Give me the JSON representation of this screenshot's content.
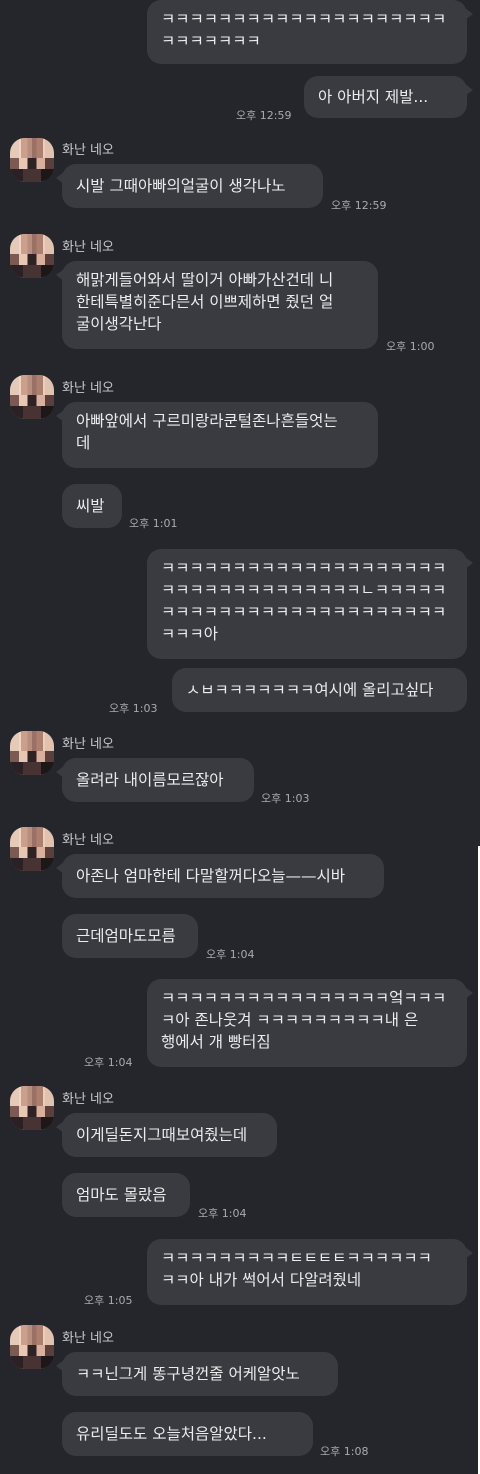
{
  "messages": [
    {
      "side": "mine",
      "text": "ㅋㅋㅋㅋㅋㅋㅋㅋㅋㅋㅋㅋㅋㅋㅋㅋㅋㅋㅋㅋ\nㅋㅋㅋㅋㅋㅋㅋ",
      "time": ""
    },
    {
      "side": "mine",
      "text": "아 아버지 제발...",
      "time": "오후 12:59"
    },
    {
      "side": "other",
      "name": "화난 네오",
      "text": "시발 그때아빠의얼굴이 생각나노",
      "time": "오후 12:59"
    },
    {
      "side": "other",
      "name": "화난 네오",
      "text": "해맑게들어와서 딸이거 아빠가산건데 니\n한테특별히준다믄서 이쁘제하면 줬던 얼\n굴이생각난다",
      "time": "오후 1:00"
    },
    {
      "side": "other",
      "name": "화난 네오",
      "text": "아빠앞에서 구르미랑라쿤털존나흔들엇는\n데",
      "time": ""
    },
    {
      "side": "other",
      "text": "씨발",
      "time": "오후 1:01"
    },
    {
      "side": "mine",
      "text": "ㅋㅋㅋㅋㅋㅋㅋㅋㅋㅋㅋㅋㅋㅋㅋㅋㅋㅋㅋㅋ\nㅋㅋㅋㅋㅋㅋㅋㅋㅋㅋㅋㅋㅋㅋㄴㅋㅋㅋㅋㅋ\nㅋㅋㅋㅋㅋㅋㅋㅋㅋㅋㅋㅋㅋㅋㅋㅋㅋㅋㅋㅋ\nㅋㅋㅋ아",
      "time": ""
    },
    {
      "side": "mine",
      "text": "ㅅㅂㅋㅋㅋㅋㅋㅋㅋ여시에 올리고싶다",
      "time": "오후 1:03"
    },
    {
      "side": "other",
      "name": "화난 네오",
      "text": "올려라 내이름모르잖아",
      "time": "오후 1:03"
    },
    {
      "side": "other",
      "name": "화난 네오",
      "text": "아존나 엄마한테 다말할꺼다오늘——시바",
      "time": ""
    },
    {
      "side": "other",
      "text": "근데엄마도모름",
      "time": "오후 1:04"
    },
    {
      "side": "mine",
      "text": "ㅋㅋㅋㅋㅋㅋㅋㅋㅋㅋㅋㅋㅋㅋㅋㅋ엌ㅋㅋㅋ\nㅋ아 존나웃겨 ㅋㅋㅋㅋㅋㅋㅋㅋㅋ내 은\n행에서 개 빵터짐",
      "time": "오후 1:04"
    },
    {
      "side": "other",
      "name": "화난 네오",
      "text": "이게딜돈지그때보여줬는데",
      "time": ""
    },
    {
      "side": "other",
      "text": "엄마도 몰랐음",
      "time": "오후 1:04"
    },
    {
      "side": "mine",
      "text": "ㅋㅋㅋㅋㅋㅋㅋㅋㅋㅌㅌㅌㅌㅋㅋㅋㅋㅋㅋ\nㅋㅋ아 내가 썩어서 다알려줬네",
      "time": "오후 1:05"
    },
    {
      "side": "other",
      "name": "화난 네오",
      "text": "ㅋㅋ닌그게 똥구녕껀줄 어케알앗노",
      "time": ""
    },
    {
      "side": "other",
      "text": "유리딜도도 오늘처음알았다...",
      "time": "오후 1:08"
    }
  ]
}
